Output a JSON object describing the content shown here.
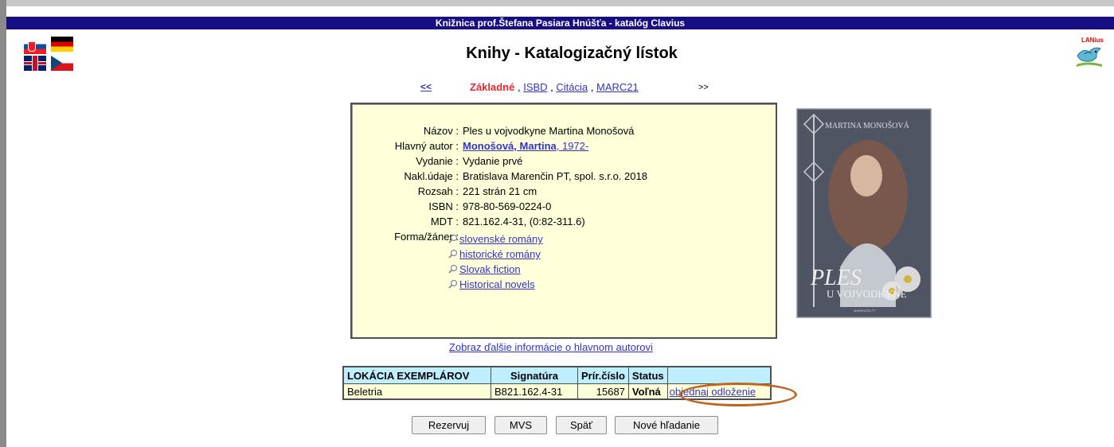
{
  "header": {
    "library_title": "Knižnica prof.Štefana Pasiara Hnúšťa - katalóg Clavius",
    "page_title": "Knihy - Katalogizačný lístok",
    "logo_text": "LANius"
  },
  "languages": [
    "sk-flag-icon",
    "de-flag-icon",
    "gb-flag-icon",
    "cz-flag-icon"
  ],
  "nav": {
    "prev": "<<",
    "tabs": [
      "Základné",
      "ISBD",
      "Citácia",
      "MARC21"
    ],
    "active_tab": "Základné",
    "next": ">>"
  },
  "record": {
    "fields": [
      {
        "label": "Názov",
        "value": "Ples u vojvodkyne Martina Monošová"
      },
      {
        "label": "Hlavný autor",
        "value": "Monošová, Martina",
        "extra": ", 1972-"
      },
      {
        "label": "Vydanie",
        "value": "Vydanie prvé"
      },
      {
        "label": "Nakl.údaje",
        "value": "Bratislava Marenčin PT, spol. s.r.o. 2018"
      },
      {
        "label": "Rozsah",
        "value": "221 strán 21 cm"
      },
      {
        "label": "ISBN",
        "value": "978-80-569-0224-0"
      },
      {
        "label": "MDT",
        "value": "821.162.4-31, (0:82-311.6)"
      }
    ],
    "genre_label": "Forma/žáner",
    "genres": [
      "slovenské romány",
      "historické romány",
      "Slovak fiction",
      "Historical novels"
    ]
  },
  "cover": {
    "author": "MARTINA MONOŠOVÁ",
    "title_big": "PLES",
    "title_small": "U VOJVODKYNE",
    "publisher": "MARENČIN PT"
  },
  "more_author_link": "Zobraz ďalšie informácie o hlavnom autorovi",
  "holdings": {
    "headers": [
      "LOKÁCIA EXEMPLÁROV",
      "Signatúra",
      "Prír.číslo",
      "Status",
      ""
    ],
    "rows": [
      {
        "location": "Beletria",
        "signature": "B821.162.4-31",
        "acc_number": "15687",
        "status": "Voľná",
        "action": "objednaj odloženie"
      }
    ]
  },
  "buttons": {
    "reserve": "Rezervuj",
    "mvs": "MVS",
    "back": "Späť",
    "new_search": "Nové hľadanie"
  },
  "colors": {
    "title_bar": "#170e85",
    "card_bg": "#ffffd9",
    "table_header": "#bfefff",
    "link": "#3333cc",
    "active_tab": "#e8262b",
    "highlight_oval": "#c0651f"
  }
}
